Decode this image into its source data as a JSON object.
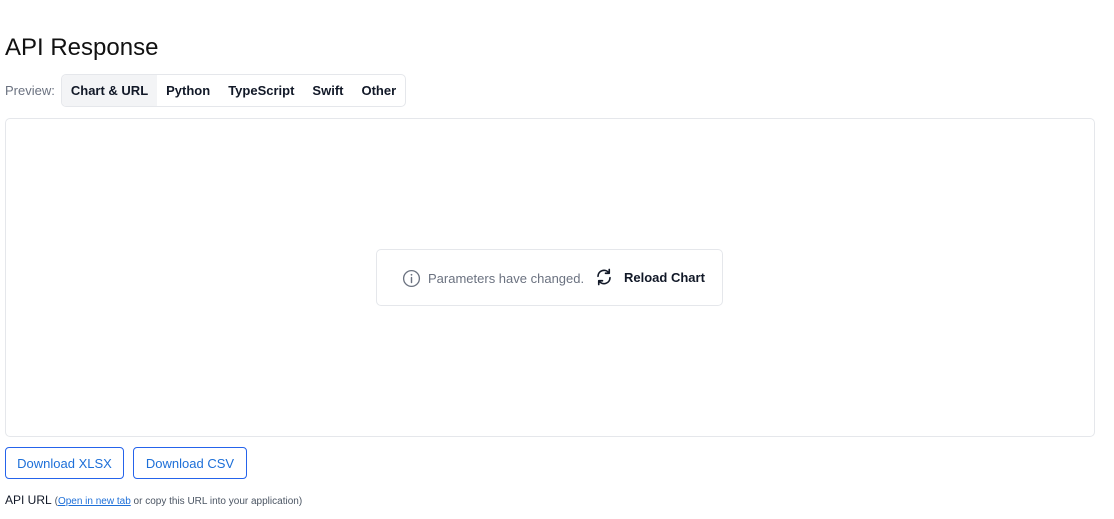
{
  "header": {
    "title": "API Response"
  },
  "preview": {
    "label": "Preview:",
    "tabs": [
      {
        "label": "Chart & URL",
        "active": true
      },
      {
        "label": "Python",
        "active": false
      },
      {
        "label": "TypeScript",
        "active": false
      },
      {
        "label": "Swift",
        "active": false
      },
      {
        "label": "Other",
        "active": false
      }
    ]
  },
  "notice": {
    "icon": "info-icon",
    "message": "Parameters have changed.",
    "reload_icon": "refresh-icon",
    "reload_label": "Reload Chart"
  },
  "downloads": {
    "xlsx_label": "Download XLSX",
    "csv_label": "Download CSV"
  },
  "api_url": {
    "label": "API URL",
    "open_paren": "(",
    "link_text": "Open in new tab",
    "suffix": " or copy this URL into your application)"
  },
  "colors": {
    "accent": "#2563eb",
    "border": "#e5e7eb",
    "muted_text": "#6b7280",
    "active_tab_bg": "#f3f4f6"
  }
}
